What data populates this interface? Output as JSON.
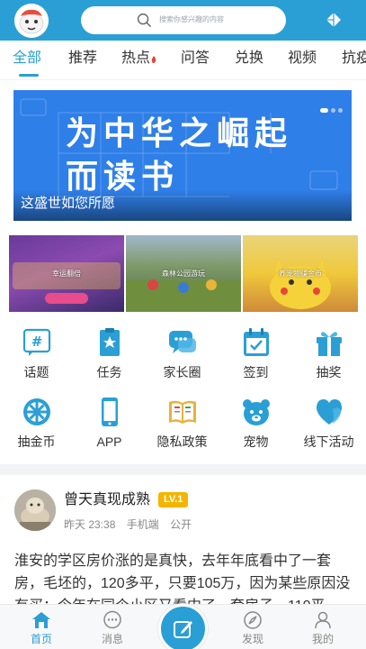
{
  "header": {
    "search_placeholder": "搜索你感兴趣的内容",
    "accent_color": "#2a9fd6",
    "logo_icon": "mascot-logo",
    "right_icon": "compass-diamond-icon"
  },
  "tabs": [
    {
      "label": "全部"
    },
    {
      "label": "推荐"
    },
    {
      "label": "热点"
    },
    {
      "label": "问答"
    },
    {
      "label": "兑换"
    },
    {
      "label": "视频"
    },
    {
      "label": "抗疫"
    }
  ],
  "banner": {
    "line1": "为中华之崛起",
    "line2": "而读书",
    "caption": "这盛世如您所愿"
  },
  "thumbnails": [
    {
      "caption": "幸运翻倍"
    },
    {
      "caption": "森林公园游玩"
    },
    {
      "caption": "养宠物赚金币"
    }
  ],
  "shortcuts": [
    {
      "label": "话题",
      "icon": "hashtag-icon"
    },
    {
      "label": "任务",
      "icon": "task-clipboard-icon"
    },
    {
      "label": "家长圈",
      "icon": "chat-bubbles-icon"
    },
    {
      "label": "签到",
      "icon": "calendar-check-icon"
    },
    {
      "label": "抽奖",
      "icon": "gift-icon"
    },
    {
      "label": "抽金币",
      "icon": "wheel-icon"
    },
    {
      "label": "APP",
      "icon": "phone-icon"
    },
    {
      "label": "隐私政策",
      "icon": "book-icon"
    },
    {
      "label": "宠物",
      "icon": "bear-icon"
    },
    {
      "label": "线下活动",
      "icon": "heart-icon"
    }
  ],
  "post": {
    "author": "曾天真现成熟",
    "level": "LV.1",
    "time": "昨天 23:38",
    "device": "手机端",
    "visibility": "公开",
    "body": "淮安的学区房价涨的是真快，去年年底看中了一套房，毛坯的，120多平，只要105万，因为某些原因没有买；今年在同个小区又看中了一套房子，110平"
  },
  "bottom_nav": [
    {
      "label": "首页",
      "icon": "home-icon"
    },
    {
      "label": "消息",
      "icon": "message-icon"
    },
    {
      "label": "发现",
      "icon": "compass-icon"
    },
    {
      "label": "我的",
      "icon": "user-icon"
    }
  ]
}
